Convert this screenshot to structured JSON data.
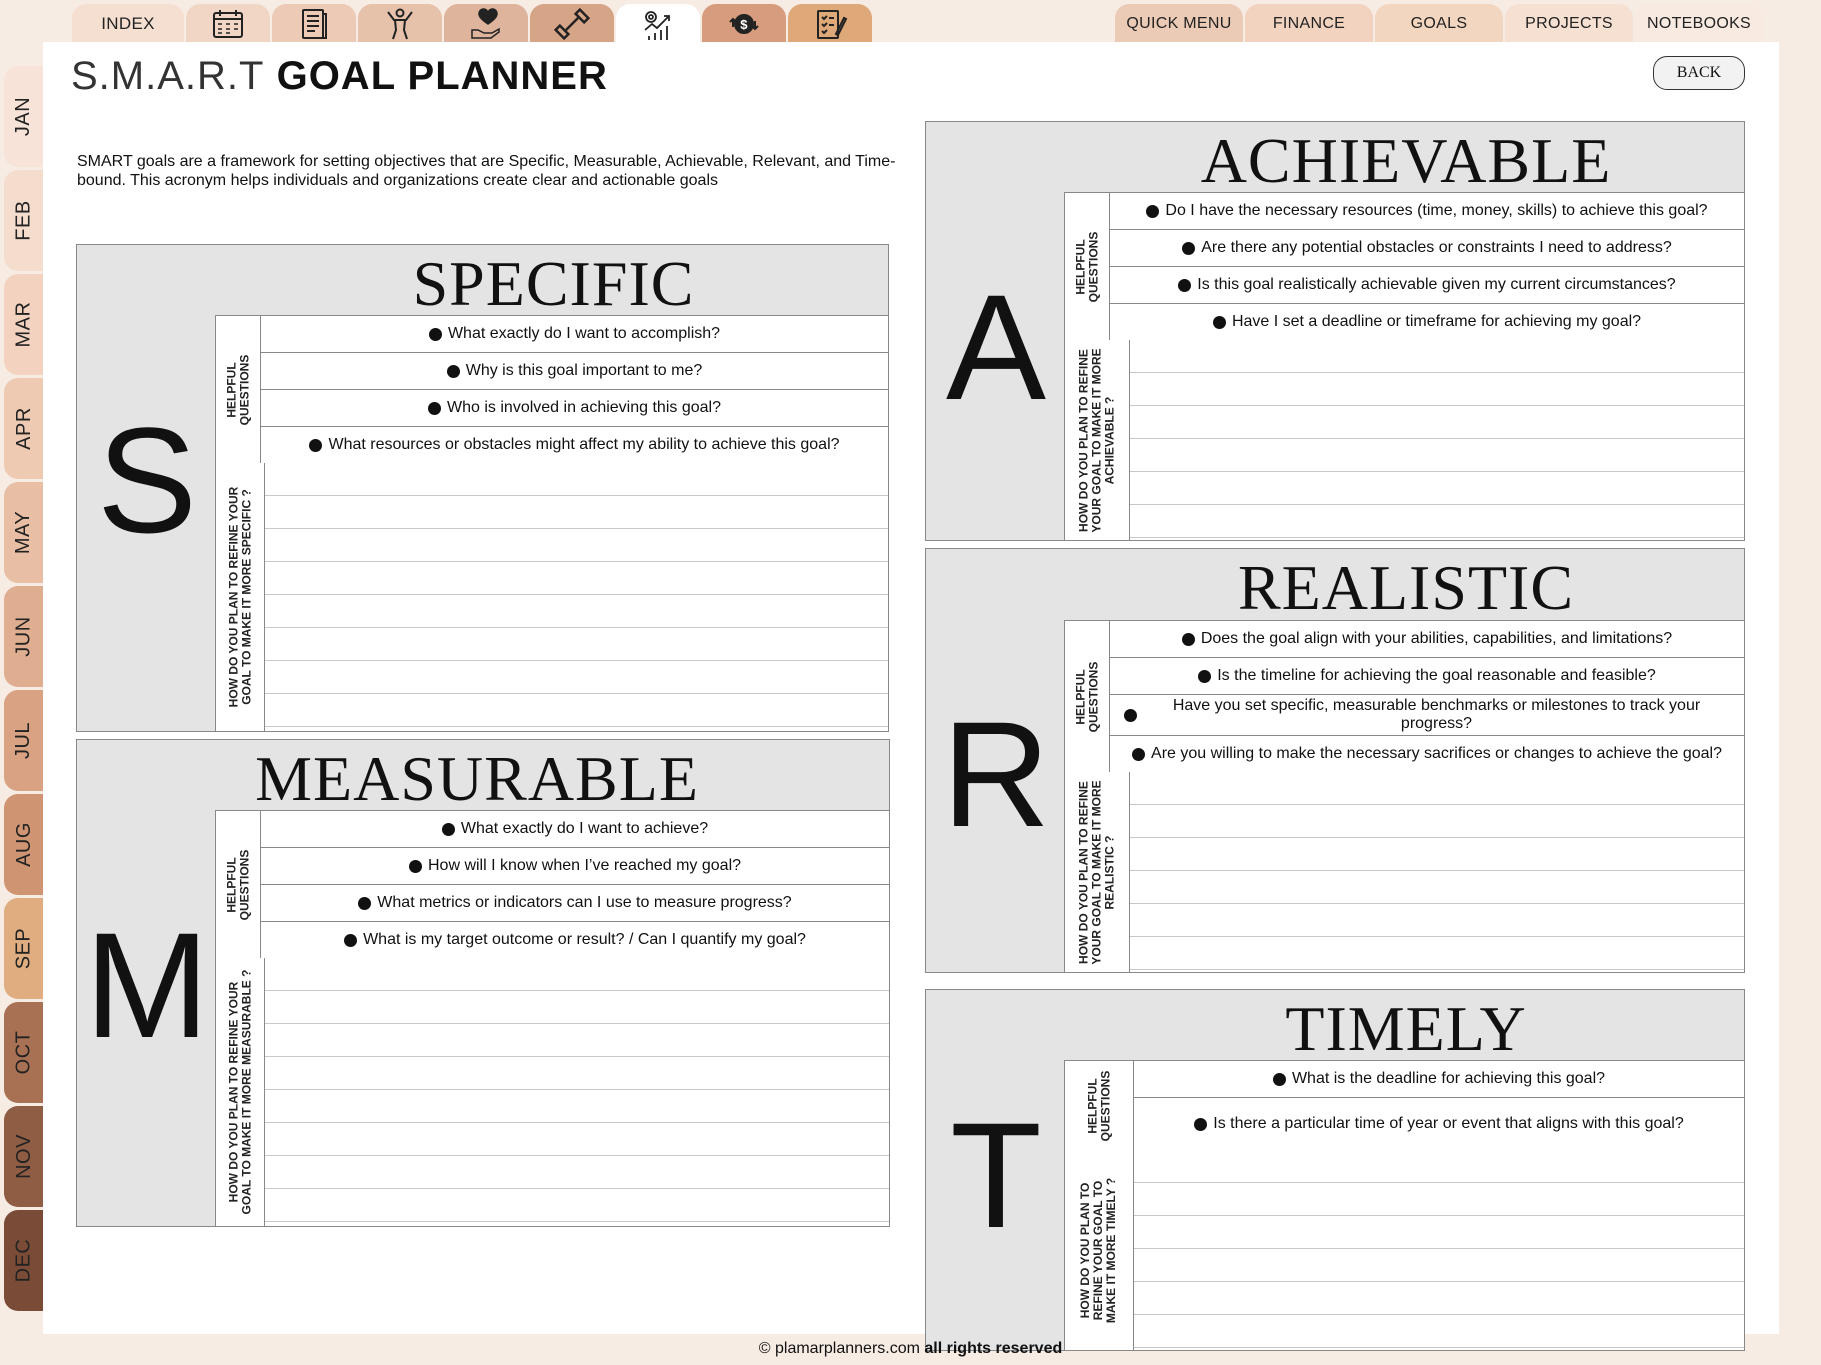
{
  "top_tabs": {
    "index_label": "INDEX",
    "icons": [
      {
        "name": "calendar-icon",
        "bg": "#f1d6c5"
      },
      {
        "name": "notes-icon",
        "bg": "#eccab6"
      },
      {
        "name": "fitness-icon",
        "bg": "#e7c2ab"
      },
      {
        "name": "selfcare-icon",
        "bg": "#dfb49c"
      },
      {
        "name": "workout-icon",
        "bg": "#d6a486"
      },
      {
        "name": "goals-icon",
        "bg": "#ffffff"
      },
      {
        "name": "money-icon",
        "bg": "#d69c7d"
      },
      {
        "name": "checklist-icon",
        "bg": "#dfa878"
      }
    ]
  },
  "right_tabs": [
    {
      "label": "QUICK MENU",
      "bg": "#eccbb6"
    },
    {
      "label": "FINANCE",
      "bg": "#f1d3c0"
    },
    {
      "label": "GOALS",
      "bg": "#f3d6bf"
    },
    {
      "label": "PROJECTS",
      "bg": "#f5e0d2"
    },
    {
      "label": "NOTEBOOKS",
      "bg": "#f8eae1"
    }
  ],
  "months": [
    {
      "label": "JAN",
      "bg": "#f7e3d8"
    },
    {
      "label": "FEB",
      "bg": "#f5ddce"
    },
    {
      "label": "MAR",
      "bg": "#f3d3bf"
    },
    {
      "label": "APR",
      "bg": "#eecab3"
    },
    {
      "label": "MAY",
      "bg": "#e8bfa4"
    },
    {
      "label": "JUN",
      "bg": "#dfae91"
    },
    {
      "label": "JUL",
      "bg": "#d8a283"
    },
    {
      "label": "AUG",
      "bg": "#cf9472"
    },
    {
      "label": "SEP",
      "bg": "#e0ad80"
    },
    {
      "label": "OCT",
      "bg": "#a97154"
    },
    {
      "label": "NOV",
      "bg": "#8f5c44"
    },
    {
      "label": "DEC",
      "bg": "#7a4c38"
    }
  ],
  "page": {
    "title_light": "S.M.A.R.T",
    "title_bold": "GOAL PLANNER",
    "back_label": "BACK",
    "intro": "SMART goals are a framework for setting objectives that are Specific, Measurable, Achievable, Relevant, and Time-bound. This acronym helps individuals and organizations create clear and actionable goals"
  },
  "questions_label_line1": "HELPFUL",
  "questions_label_line2": "QUESTIONS",
  "sections": {
    "specific": {
      "letter": "S",
      "title": "SPECIFIC",
      "refine_line1": "HOW DO YOU PLAN TO REFINE YOUR",
      "refine_line2": "GOAL TO MAKE IT MORE SPECIFIC ?",
      "questions": [
        "What exactly do I want to accomplish?",
        "Why is this goal important to me?",
        "Who is involved in achieving this goal?",
        "What resources or obstacles might affect my ability to achieve this goal?"
      ]
    },
    "measurable": {
      "letter": "M",
      "title": "MEASURABLE",
      "refine_line1": "HOW DO YOU PLAN TO REFINE YOUR",
      "refine_line2": "GOAL TO MAKE IT MORE MEASURABLE ?",
      "questions": [
        "What exactly do I want to achieve?",
        "How will I know when I’ve reached my goal?",
        "What metrics or indicators can I use to measure progress?",
        "What is my target outcome or result? / Can I quantify my goal?"
      ]
    },
    "achievable": {
      "letter": "A",
      "title": "ACHIEVABLE",
      "refine_line1": "HOW DO YOU PLAN TO REFINE",
      "refine_line2": "YOUR GOAL TO MAKE IT MORE",
      "refine_line3": "ACHIEVABLE ?",
      "questions": [
        "Do I have the necessary resources (time, money, skills) to achieve this goal?",
        "Are there any potential obstacles or constraints I need to address?",
        "Is this goal realistically achievable given my current circumstances?",
        "Have I set a deadline or timeframe for achieving my goal?"
      ]
    },
    "realistic": {
      "letter": "R",
      "title": "REALISTIC",
      "refine_line1": "HOW DO YOU PLAN TO REFINE",
      "refine_line2": "YOUR GOAL TO MAKE IT MORE",
      "refine_line3": "REALISTIC ?",
      "questions": [
        "Does the goal align with your abilities, capabilities, and limitations?",
        "Is the timeline for achieving the goal reasonable and feasible?",
        "Have you set specific, measurable benchmarks or milestones to track your progress?",
        "Are you willing to make the necessary sacrifices or changes to achieve the goal?"
      ]
    },
    "timely": {
      "letter": "T",
      "title": "TIMELY",
      "refine_line1": "HOW DO YOU PLAN TO",
      "refine_line2": "REFINE YOUR GOAL TO",
      "refine_line3": "MAKE IT MORE TIMELY ?",
      "questions": [
        "What is the deadline for achieving this goal?",
        "Is there a particular time of year or event that aligns with this goal?"
      ]
    }
  },
  "footer": {
    "site": "© plamarplanners.com",
    "rights": "all rights reserved"
  }
}
